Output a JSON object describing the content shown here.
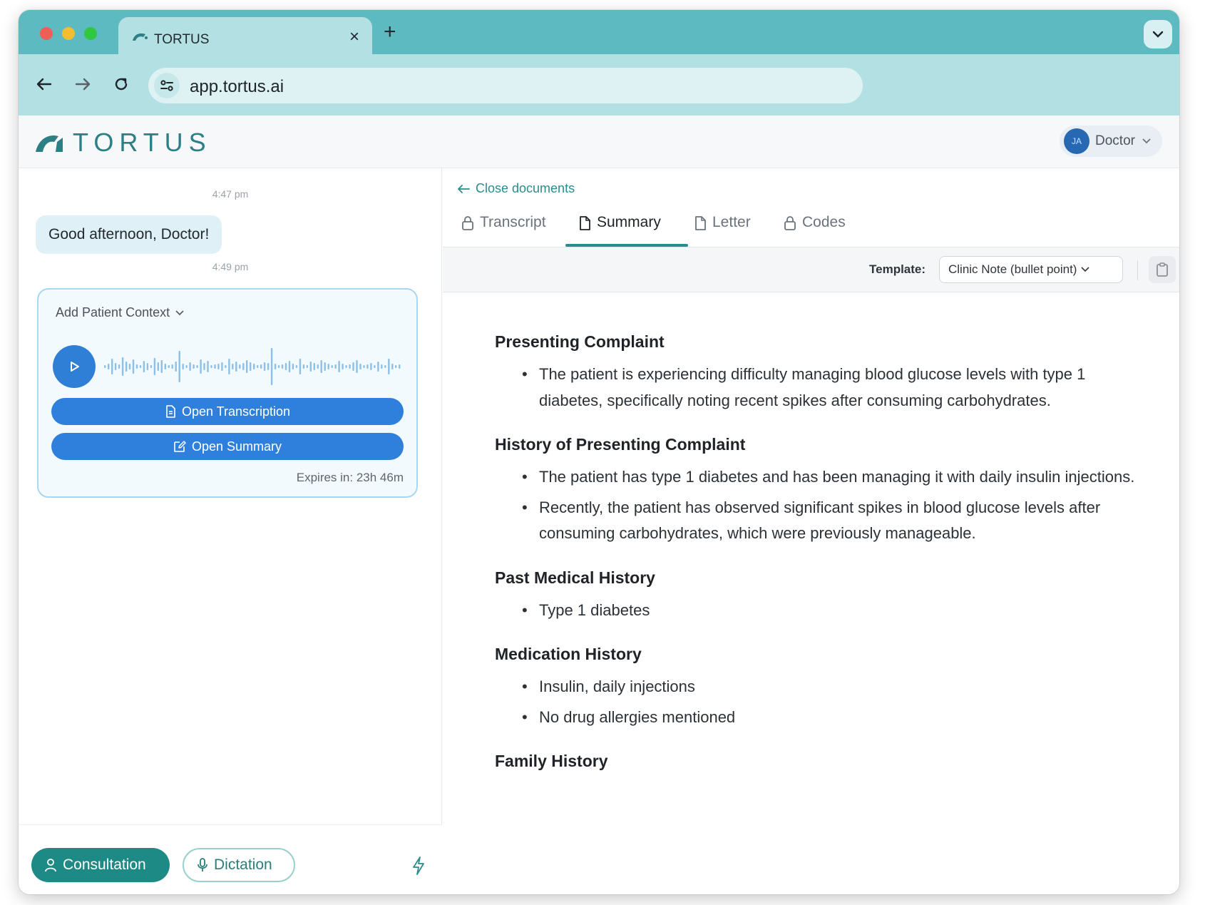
{
  "browser": {
    "tab_title": "TORTUS",
    "tab_close": "×",
    "new_tab": "+",
    "url": "app.tortus.ai"
  },
  "header": {
    "logo_text": "TORTUS",
    "avatar_initials": "JA",
    "user_role": "Doctor"
  },
  "chat": {
    "time_1": "4:47 pm",
    "greeting": "Good afternoon, Doctor!",
    "time_2": "4:49 pm",
    "card": {
      "context_label": "Add Patient Context",
      "open_transcription": "Open Transcription",
      "open_summary": "Open Summary",
      "expires": "Expires in: 23h 46m"
    }
  },
  "footer": {
    "consultation": "Consultation",
    "dictation": "Dictation"
  },
  "documents": {
    "close_label": "Close documents",
    "tabs": [
      {
        "label": "Transcript",
        "icon": "lock-icon",
        "active": false
      },
      {
        "label": "Summary",
        "icon": "document-icon",
        "active": true
      },
      {
        "label": "Letter",
        "icon": "document-icon",
        "active": false
      },
      {
        "label": "Codes",
        "icon": "lock-icon",
        "active": false
      }
    ],
    "template_label": "Template:",
    "template_value": "Clinic Note (bullet point)",
    "sections": [
      {
        "heading": "Presenting Complaint",
        "items": [
          "The patient is experiencing difficulty managing blood glucose levels with type 1 diabetes, specifically noting recent spikes after consuming carbohydrates."
        ]
      },
      {
        "heading": "History of Presenting Complaint",
        "items": [
          "The patient has type 1 diabetes and has been managing it with daily insulin injections.",
          "Recently, the patient has observed significant spikes in blood glucose levels after consuming carbohydrates, which were previously manageable."
        ]
      },
      {
        "heading": "Past Medical History",
        "items": [
          "Type 1 diabetes"
        ]
      },
      {
        "heading": "Medication History",
        "items": [
          "Insulin, daily injections",
          "No drug allergies mentioned"
        ]
      },
      {
        "heading": "Family History",
        "items": []
      }
    ]
  },
  "colors": {
    "brand_teal": "#2a8c8c",
    "primary_blue": "#2f80dc",
    "tab_bar": "#5ebac1"
  }
}
